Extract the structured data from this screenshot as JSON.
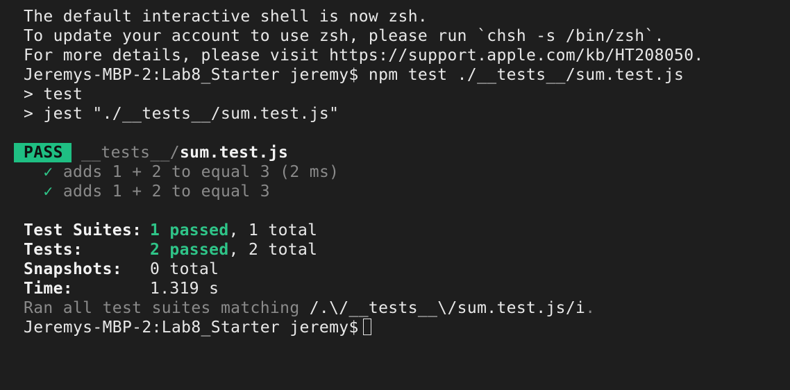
{
  "terminal": {
    "banner": [
      "The default interactive shell is now zsh.",
      "To update your account to use zsh, please run `chsh -s /bin/zsh`.",
      "For more details, please visit https://support.apple.com/kb/HT208050."
    ],
    "command_line": "Jeremys-MBP-2:Lab8_Starter jeremy$ npm test ./__tests__/sum.test.js",
    "npm_script_name": "> test",
    "npm_script_cmd": "> jest \"./__tests__/sum.test.js\"",
    "result": {
      "status": "PASS",
      "path_dir": "__tests__/",
      "path_file": "sum.test.js"
    },
    "tests": [
      {
        "check": "✓",
        "name": "adds 1 + 2 to equal 3 (2 ms)"
      },
      {
        "check": "✓",
        "name": "adds 1 + 2 to equal 3"
      }
    ],
    "summary": {
      "suites_label": "Test Suites:",
      "suites_passed": "1 passed",
      "suites_total": ", 1 total",
      "tests_label": "Tests:",
      "tests_passed": "2 passed",
      "tests_total": ", 2 total",
      "snapshots_label": "Snapshots:",
      "snapshots_value": "0 total",
      "time_label": "Time:",
      "time_value": "1.319 s"
    },
    "ran_text": "Ran all test suites matching ",
    "ran_pattern": "/.\\/__tests__\\/sum.test.js/i",
    "ran_end": ".",
    "prompt": "Jeremys-MBP-2:Lab8_Starter jeremy$"
  },
  "colors": {
    "background": "#1e1e1e",
    "text": "#e8e8e8",
    "dim": "#8a8a8a",
    "pass_green": "#2fc488",
    "badge_bg": "#1fbf83"
  }
}
